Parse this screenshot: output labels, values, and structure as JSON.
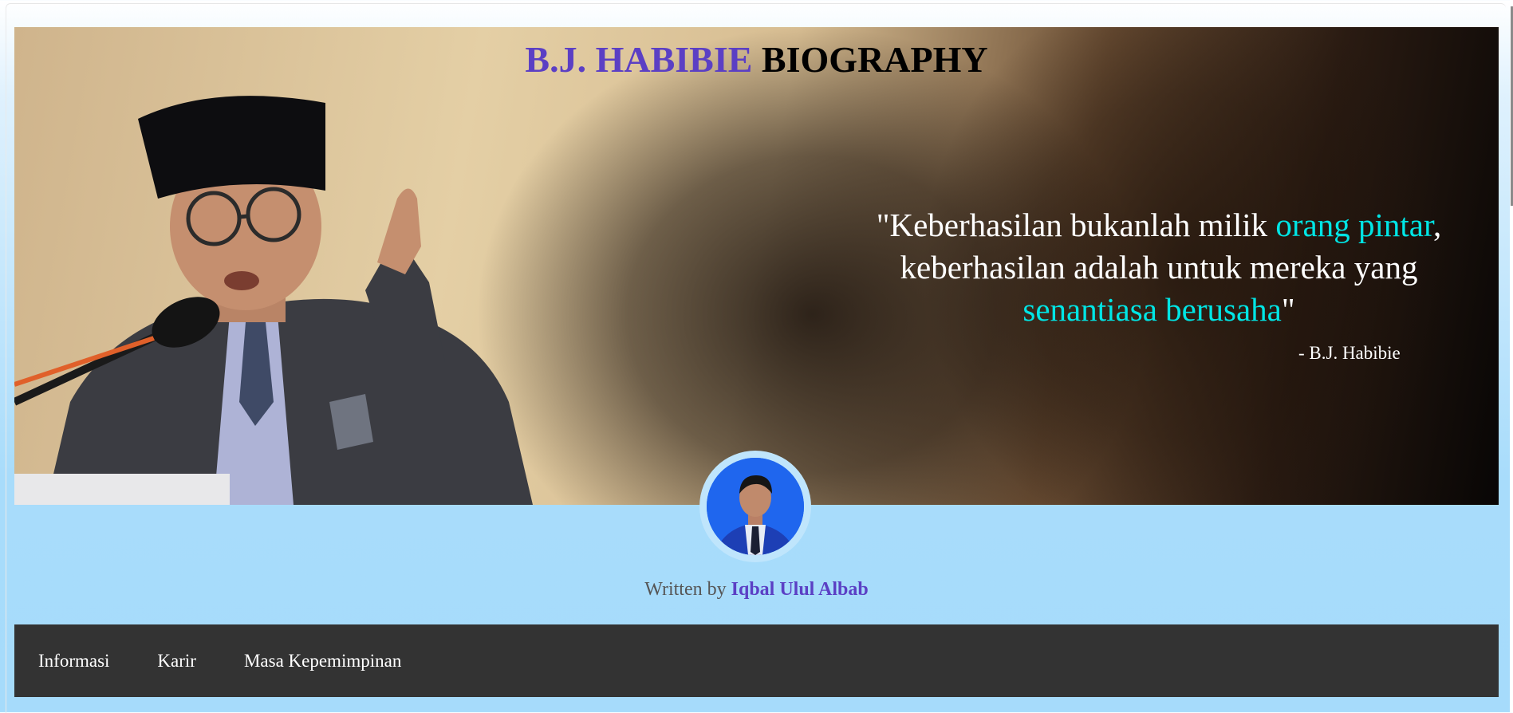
{
  "hero": {
    "title_accent": "B.J. HABIBIE",
    "title_rest": "BIOGRAPHY",
    "quote": {
      "open": "\"Keberhasilan bukanlah milik ",
      "highlight1": "orang pintar",
      "middle": ", keberhasilan adalah untuk mereka yang ",
      "highlight2": "senantiasa berusaha",
      "close": "\""
    },
    "quote_author": "- B.J. Habibie"
  },
  "byline": {
    "prefix": "Written by ",
    "author": "Iqbal Ulul Albab"
  },
  "nav": {
    "items": [
      {
        "label": "Informasi"
      },
      {
        "label": "Karir"
      },
      {
        "label": "Masa Kepemimpinan"
      }
    ]
  },
  "colors": {
    "accent_purple": "#5b3fc4",
    "highlight_cyan": "#00e5e5",
    "navbar_bg": "#333333",
    "page_bg": "#a6dbfb"
  }
}
